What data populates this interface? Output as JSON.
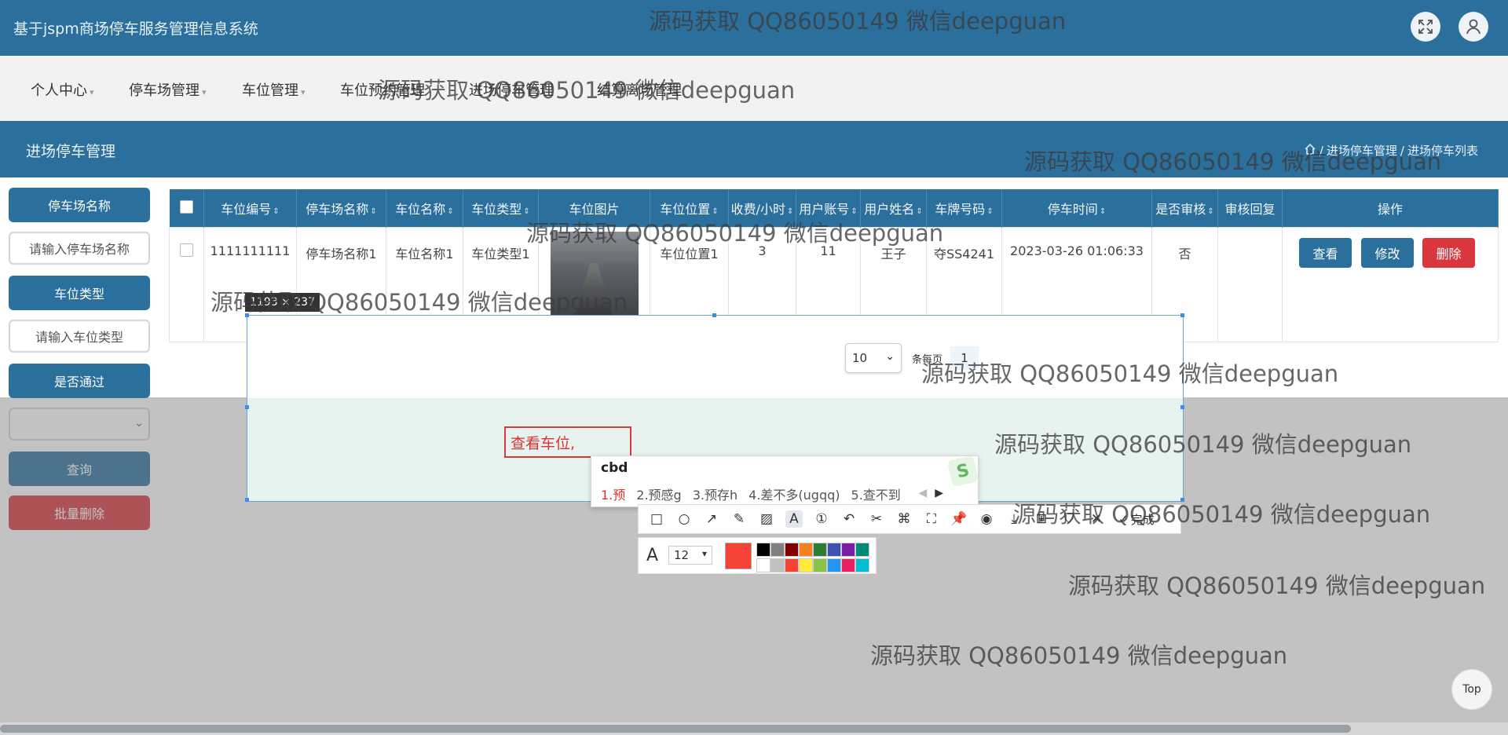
{
  "header": {
    "app_title": "基于jspm商场停车服务管理信息系统"
  },
  "nav": {
    "items": [
      {
        "label": "个人中心",
        "has_caret": true
      },
      {
        "label": "停车场管理",
        "has_caret": true
      },
      {
        "label": "车位管理",
        "has_caret": true
      },
      {
        "label": "车位预约管理",
        "has_caret": false
      },
      {
        "label": "进场停车管理",
        "has_caret": false
      },
      {
        "label": "结算离场管理",
        "has_caret": false
      }
    ]
  },
  "page": {
    "title": "进场停车管理",
    "breadcrumb": [
      "进场停车管理",
      "进场停车列表"
    ]
  },
  "sidebar": {
    "parking_lot_label": "停车场名称",
    "parking_lot_placeholder": "请输入停车场名称",
    "space_type_label": "车位类型",
    "space_type_placeholder": "请输入车位类型",
    "approved_label": "是否通过",
    "approved_value": "",
    "query_button": "查询",
    "batch_delete_button": "批量删除"
  },
  "table": {
    "columns": [
      "车位编号",
      "停车场名称",
      "车位名称",
      "车位类型",
      "车位图片",
      "车位位置",
      "收费/小时",
      "用户账号",
      "用户姓名",
      "车牌号码",
      "停车时间",
      "是否审核",
      "审核回复",
      "操作"
    ],
    "rows": [
      {
        "space_no": "1111111111",
        "lot_name": "停车场名称1",
        "space_name": "车位名称1",
        "space_type": "车位类型1",
        "location": "车位位置1",
        "fee": "3",
        "account": "11",
        "user_name": "王子",
        "plate": "夺SS4241",
        "park_time": "2023-03-26 01:06:33",
        "reviewed": "否",
        "reply": ""
      }
    ],
    "actions": {
      "view": "查看",
      "edit": "修改",
      "delete": "删除"
    }
  },
  "pagination": {
    "page_size": "10",
    "per_page_label": "条每页",
    "current_page": "1"
  },
  "capture": {
    "size_label": "1193 × 237",
    "annotation_text": "查看车位,",
    "ime_input": "cbd",
    "ime_candidates": [
      "1.预",
      "2.预感g",
      "3.预存h",
      "4.差不多(ugqq)",
      "5.查不到"
    ],
    "done_label": "完成",
    "font_size": "12"
  },
  "colors": {
    "primary": "#2b6f9d",
    "danger": "#d9363e",
    "annotation_red": "#f44336",
    "palette": [
      "#000000",
      "#808080",
      "#800000",
      "#f58220",
      "#2e7d32",
      "#3f51b5",
      "#7b1fa2",
      "#00897b",
      "#ffffff",
      "#c0c0c0",
      "#f44336",
      "#ffeb3b",
      "#8bc34a",
      "#2196f3",
      "#e91e63",
      "#00bcd4"
    ]
  },
  "watermark": "源码获取 QQ86050149 微信deepguan",
  "misc": {
    "top_button": "Top"
  }
}
